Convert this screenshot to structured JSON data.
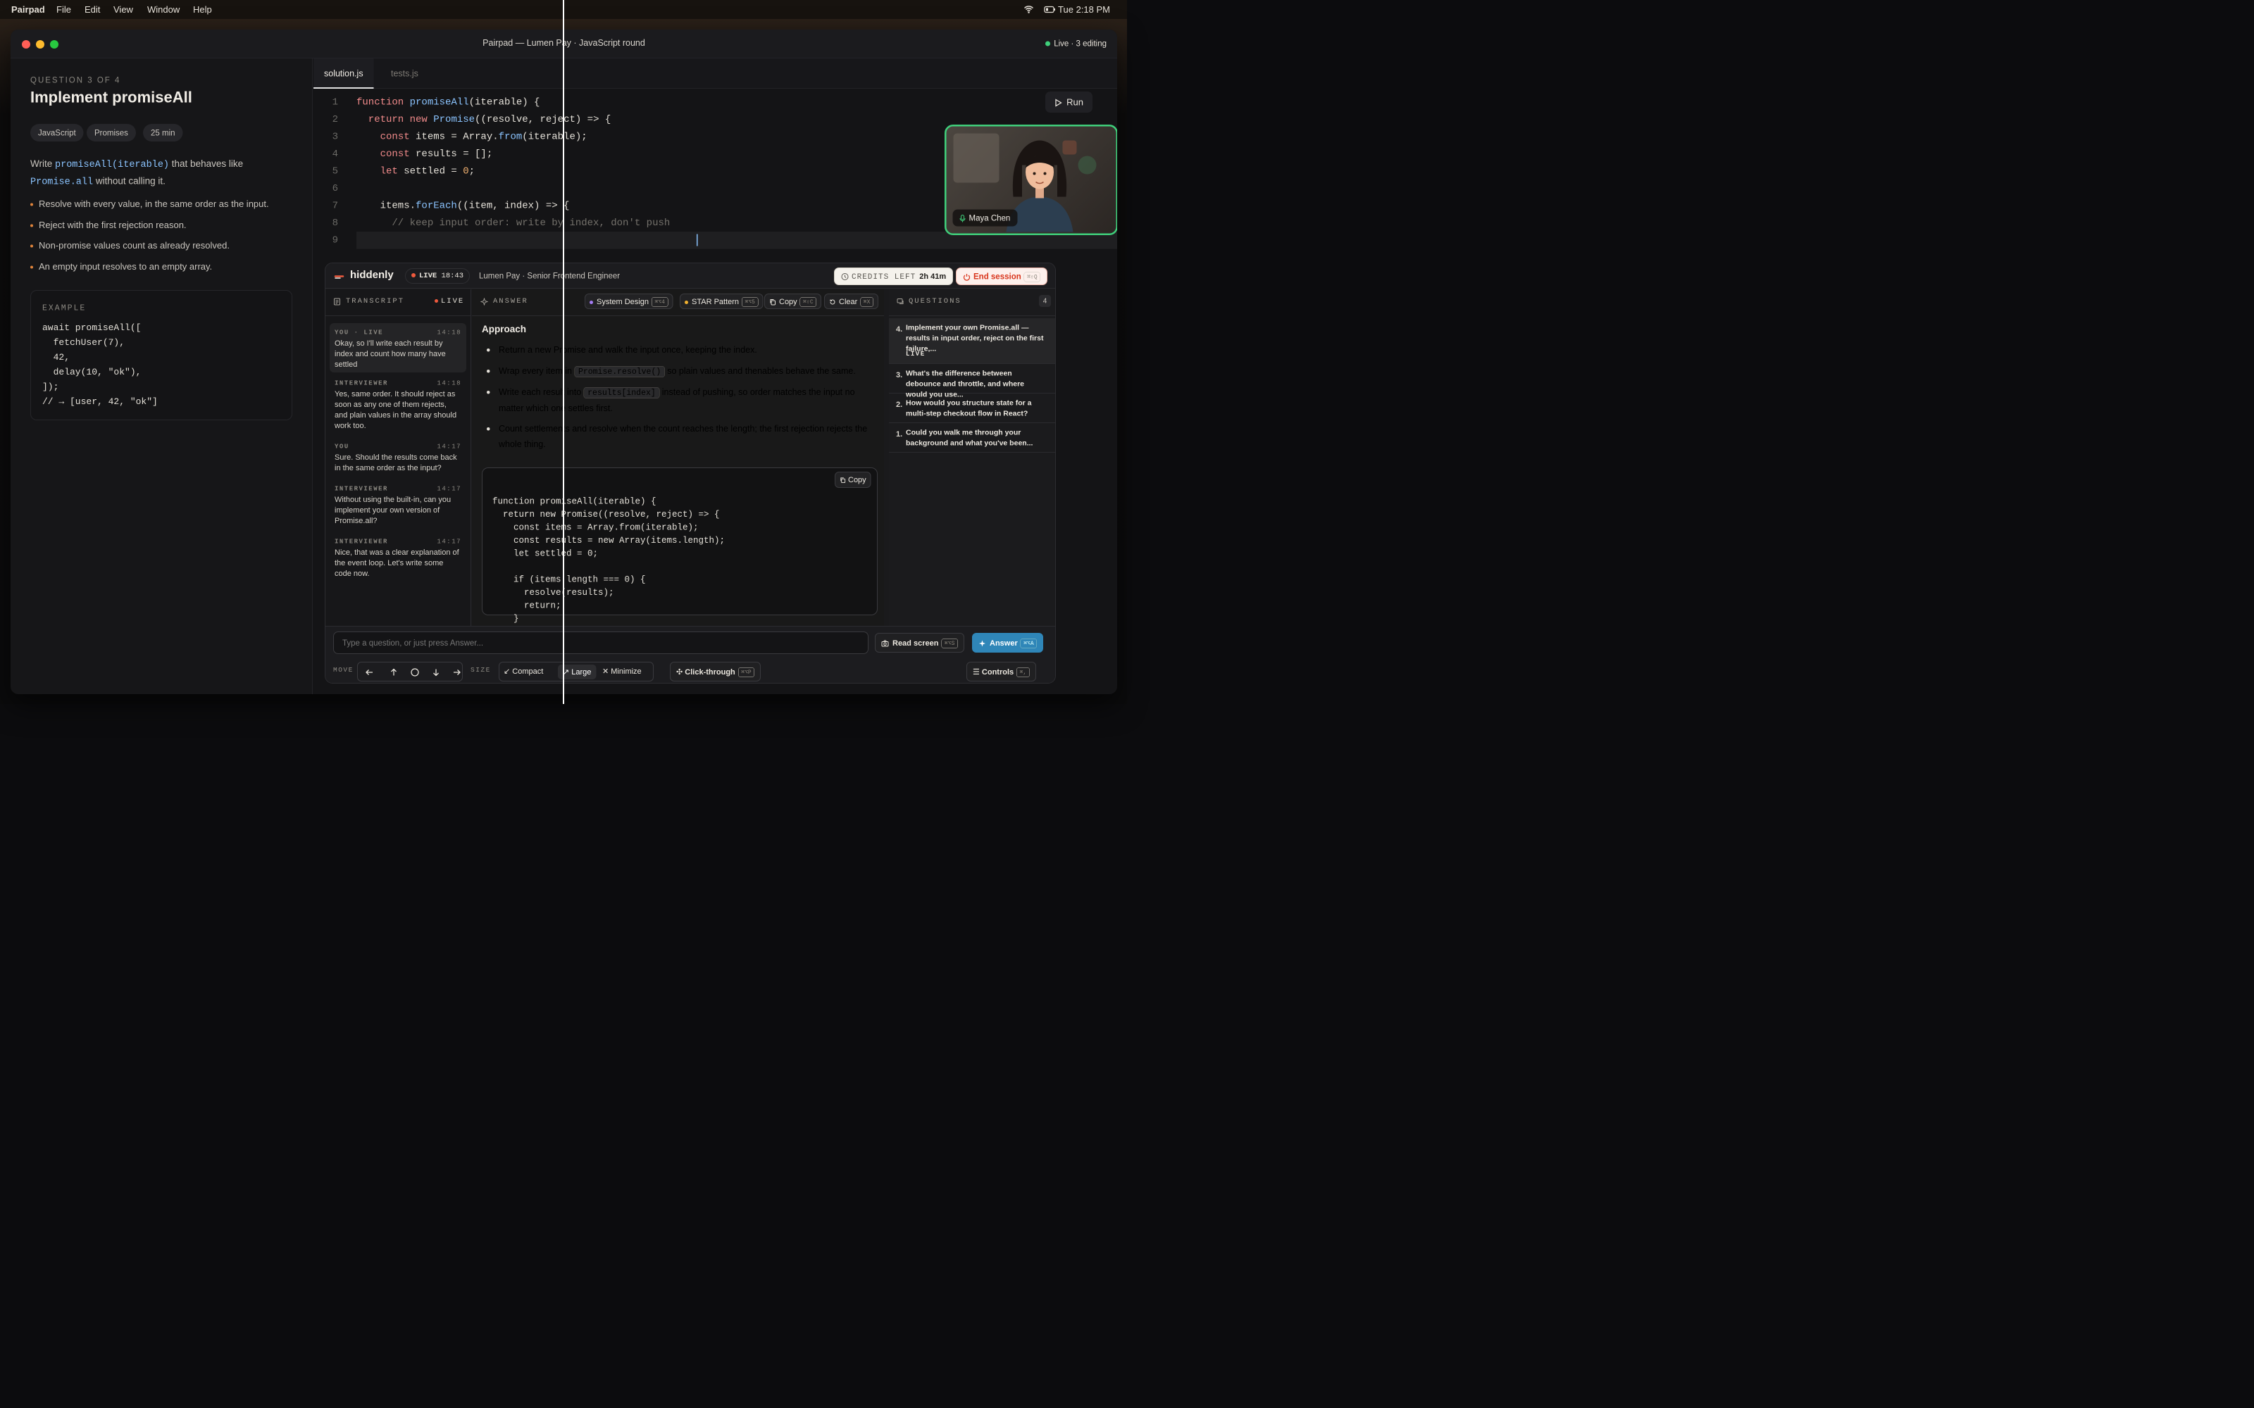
{
  "menubar": {
    "app": "Pairpad",
    "items": [
      "File",
      "Edit",
      "View",
      "Window",
      "Help"
    ],
    "clock": "Tue 2:18 PM"
  },
  "window": {
    "title": "Pairpad — Lumen Pay · JavaScript round",
    "status": "Live · 3 editing"
  },
  "problem": {
    "counter": "QUESTION 3 OF 4",
    "title": "Implement promiseAll",
    "tags": [
      "JavaScript",
      "Promises",
      "25 min"
    ],
    "desc_pre": "Write ",
    "desc_code": "promiseAll(iterable)",
    "desc_mid": " that behaves like ",
    "desc_code2": "Promise.all",
    "desc_post": " without calling it.",
    "rules": [
      "Resolve with every value, in the same order as the input.",
      "Reject with the first rejection reason.",
      "Non-promise values count as already resolved.",
      "An empty input resolves to an empty array."
    ],
    "example_label": "EXAMPLE",
    "example_code": "await promiseAll([\n  fetchUser(7),\n  42,\n  delay(10, \"ok\"),\n]);\n// → [user, 42, \"ok\"]"
  },
  "editor": {
    "tabs": [
      "solution.js",
      "tests.js"
    ],
    "run": "Run",
    "line_numbers": [
      "1",
      "2",
      "3",
      "4",
      "5",
      "6",
      "7",
      "8",
      "9"
    ]
  },
  "video": {
    "name": "Maya Chen"
  },
  "assistant": {
    "brand": "hiddenly",
    "live": "LIVE",
    "live_time": "18:43",
    "role": "Lumen Pay · Senior Frontend Engineer",
    "credits_label": "CREDITS LEFT",
    "credits_value": "2h 41m",
    "end": "End session",
    "end_key": "⌘⇧Q",
    "transcript_label": "TRANSCRIPT",
    "transcript_live": "LIVE",
    "messages": [
      {
        "who": "YOU · LIVE",
        "time": "14:18",
        "text": "Okay, so I'll write each result by index and count how many have settled"
      },
      {
        "who": "INTERVIEWER",
        "time": "14:18",
        "text": "Yes, same order. It should reject as soon as any one of them rejects, and plain values in the array should work too."
      },
      {
        "who": "YOU",
        "time": "14:17",
        "text": "Sure. Should the results come back in the same order as the input?"
      },
      {
        "who": "INTERVIEWER",
        "time": "14:17",
        "text": "Without using the built-in, can you implement your own version of Promise.all?"
      },
      {
        "who": "INTERVIEWER",
        "time": "14:17",
        "text": "Nice, that was a clear explanation of the event loop. Let's write some code now."
      }
    ],
    "answer_label": "ANSWER",
    "modes": [
      {
        "label": "System Design",
        "key": "⌘⌥4"
      },
      {
        "label": "STAR Pattern",
        "key": "⌘⌥5"
      }
    ],
    "copy": "Copy",
    "copy_key": "⌘⇧C",
    "clear": "Clear",
    "clear_key": "⌘X",
    "approach": "Approach",
    "points": [
      {
        "a": "Return a new Promise and walk the input once, keeping the index.",
        "code": "",
        "b": ""
      },
      {
        "a": "Wrap every item in ",
        "code": "Promise.resolve()",
        "b": " so plain values and thenables behave the same."
      },
      {
        "a": "Write each result into ",
        "code": "results[index]",
        "b": " instead of pushing, so order matches the input no matter which one settles first."
      },
      {
        "a": "Count settlements and resolve when the count reaches the length; the first rejection rejects the whole thing.",
        "code": "",
        "b": ""
      }
    ],
    "codeblock_copy": "Copy",
    "codeblock": "function promiseAll(iterable) {\n  return new Promise((resolve, reject) => {\n    const items = Array.from(iterable);\n    const results = new Array(items.length);\n    let settled = 0;\n\n    if (items.length === 0) {\n      resolve(results);\n      return;\n    }",
    "questions_label": "QUESTIONS",
    "questions_count": "4",
    "questions": [
      {
        "n": "4.",
        "t": "Implement your own Promise.all — results in input order, reject on the first failure,...",
        "live": "LIVE"
      },
      {
        "n": "3.",
        "t": "What's the difference between debounce and throttle, and where would you use..."
      },
      {
        "n": "2.",
        "t": "How would you structure state for a multi-step checkout flow in React?"
      },
      {
        "n": "1.",
        "t": "Could you walk me through your background and what you've been..."
      }
    ],
    "input_placeholder": "Type a question, or just press Answer...",
    "read_screen": "Read screen",
    "read_key": "⌘⌥S",
    "answer_btn": "Answer",
    "answer_key": "⌘⌥A",
    "move_label": "MOVE",
    "size_label": "SIZE",
    "size_opts": [
      "Compact",
      "Large",
      "Minimize"
    ],
    "clickthrough": "Click-through",
    "click_key": "⌘⌥P",
    "controls": "Controls",
    "controls_key": "⌘,"
  }
}
